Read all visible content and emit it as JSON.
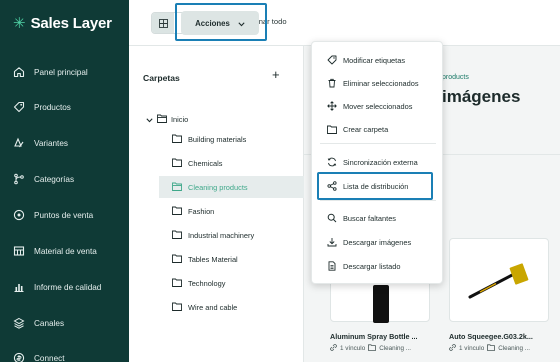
{
  "app": {
    "name": "Sales Layer"
  },
  "sidebar": {
    "items": [
      {
        "label": "Panel principal",
        "icon": "home-icon"
      },
      {
        "label": "Productos",
        "icon": "tag-icon"
      },
      {
        "label": "Variantes",
        "icon": "variants-icon"
      },
      {
        "label": "Categorías",
        "icon": "categories-icon"
      },
      {
        "label": "Puntos de venta",
        "icon": "location-pin-icon"
      },
      {
        "label": "Material de venta",
        "icon": "sales-material-icon"
      },
      {
        "label": "Informe de calidad",
        "icon": "bar-chart-icon"
      },
      {
        "label": "Canales",
        "icon": "layers-icon"
      },
      {
        "label": "Connect",
        "icon": "connect-icon"
      }
    ]
  },
  "toolbar": {
    "select_all_label": "Seleccionar todo",
    "actions_label": "Acciones"
  },
  "folders": {
    "title": "Carpetas",
    "add_symbol": "+",
    "root_label": "Inicio",
    "items": [
      {
        "label": "Building materials",
        "selected": false
      },
      {
        "label": "Chemicals",
        "selected": false
      },
      {
        "label": "Cleaning products",
        "selected": true
      },
      {
        "label": "Fashion",
        "selected": false
      },
      {
        "label": "Industrial machinery",
        "selected": false
      },
      {
        "label": "Tables Material",
        "selected": false
      },
      {
        "label": "Technology",
        "selected": false
      },
      {
        "label": "Wire and cable",
        "selected": false
      }
    ]
  },
  "main": {
    "breadcrumb": "products",
    "title": "imágenes",
    "cards": [
      {
        "name": "Aluminum Spray Bottle ...",
        "links": "1 vínculo",
        "folder": "Cleaning ..."
      },
      {
        "name": "Auto Squeegee.G03.2k...",
        "links": "1 vínculo",
        "folder": "Cleaning ..."
      }
    ]
  },
  "actions_menu": {
    "items": [
      {
        "label": "Modificar etiquetas",
        "icon": "tag-icon"
      },
      {
        "label": "Eliminar seleccionados",
        "icon": "trash-icon"
      },
      {
        "label": "Mover seleccionados",
        "icon": "move-icon"
      },
      {
        "label": "Crear carpeta",
        "icon": "folder-icon"
      },
      {
        "label": "Sincronización externa",
        "icon": "sync-icon"
      },
      {
        "label": "Lista de distribución",
        "icon": "share-icon"
      },
      {
        "label": "Buscar faltantes",
        "icon": "search-icon"
      },
      {
        "label": "Descargar imágenes",
        "icon": "download-icon"
      },
      {
        "label": "Descargar listado",
        "icon": "document-icon"
      }
    ]
  },
  "colors": {
    "sidebar_bg": "#0f3a36",
    "accent_green": "#3fa88a",
    "highlight_blue": "#1a7fb5"
  }
}
